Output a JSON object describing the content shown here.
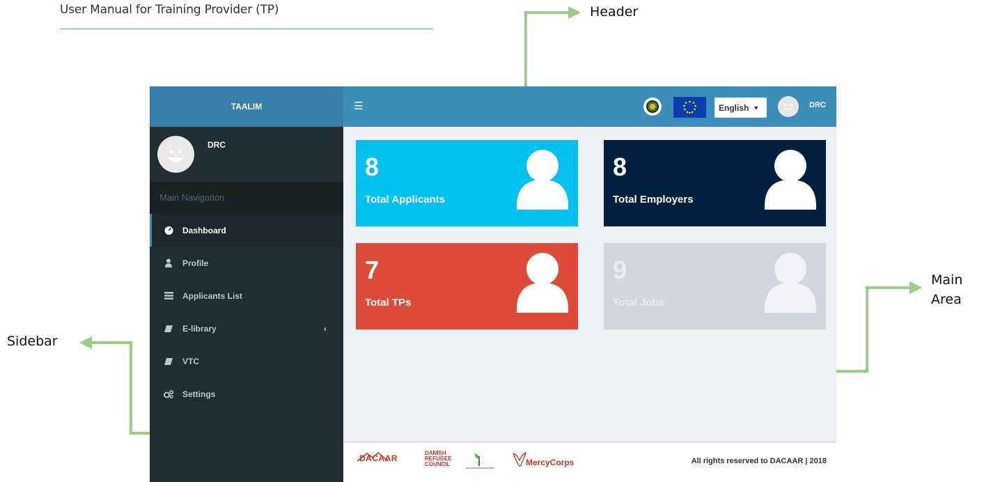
{
  "document": {
    "title": "User Manual for Training Provider (TP)",
    "callouts": {
      "header": "Header",
      "main_area": "Main Area",
      "sidebar": "Sidebar"
    }
  },
  "app": {
    "brand": "TAALIM",
    "language": {
      "selected": "English"
    },
    "user": "DRC",
    "sidebar": {
      "username": "DRC",
      "section_header": "Main Navigation",
      "items": [
        {
          "label": "Dashboard",
          "icon": "dashboard-icon",
          "active": true
        },
        {
          "label": "Profile",
          "icon": "user-icon"
        },
        {
          "label": "Applicants List",
          "icon": "list-icon"
        },
        {
          "label": "E-library",
          "icon": "book-icon",
          "has_submenu": true
        },
        {
          "label": "VTC",
          "icon": "book-icon"
        },
        {
          "label": "Settings",
          "icon": "gears-icon"
        }
      ]
    },
    "cards": [
      {
        "value": "8",
        "label": "Total Applicants",
        "color": "#00c0ef"
      },
      {
        "value": "8",
        "label": "Total Employers",
        "color": "#001f3f"
      },
      {
        "value": "7",
        "label": "Total TPs",
        "color": "#dd4b39"
      },
      {
        "value": "9",
        "label": "Total Jobs",
        "color": "#d2d6de"
      }
    ],
    "footer": {
      "copyright": "All rights reserved to DACAAR | 2018",
      "logos": {
        "dacaar": "DACAAR",
        "drc": [
          "DANISH",
          "REFUGEE",
          "COUNCIL"
        ],
        "mercy_corps": "MercyCorps"
      }
    },
    "colors": {
      "header": "#3c8dbc",
      "sidebar": "#222d32",
      "callout_arrow": "#9ccc86"
    }
  }
}
